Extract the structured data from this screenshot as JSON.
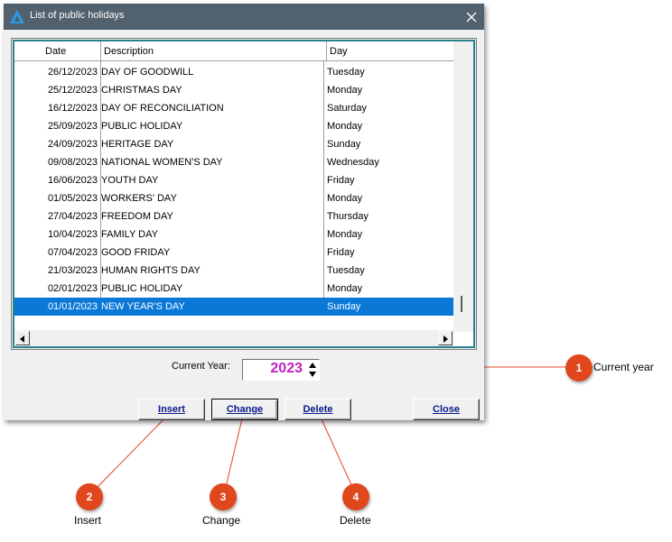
{
  "window": {
    "title": "List of public holidays",
    "icon": "app-triangle-icon",
    "close_icon": "close-icon"
  },
  "table": {
    "columns": [
      "Date",
      "Description",
      "Day"
    ],
    "rows": [
      {
        "date": "26/12/2023",
        "description": "DAY OF GOODWILL",
        "day": "Tuesday"
      },
      {
        "date": "25/12/2023",
        "description": "CHRISTMAS DAY",
        "day": "Monday"
      },
      {
        "date": "16/12/2023",
        "description": "DAY OF RECONCILIATION",
        "day": "Saturday"
      },
      {
        "date": "25/09/2023",
        "description": "PUBLIC HOLIDAY",
        "day": "Monday"
      },
      {
        "date": "24/09/2023",
        "description": "HERITAGE DAY",
        "day": "Sunday"
      },
      {
        "date": "09/08/2023",
        "description": "NATIONAL WOMEN'S DAY",
        "day": "Wednesday"
      },
      {
        "date": "16/06/2023",
        "description": "YOUTH DAY",
        "day": "Friday"
      },
      {
        "date": "01/05/2023",
        "description": "WORKERS' DAY",
        "day": "Monday"
      },
      {
        "date": "27/04/2023",
        "description": "FREEDOM DAY",
        "day": "Thursday"
      },
      {
        "date": "10/04/2023",
        "description": "FAMILY DAY",
        "day": "Monday"
      },
      {
        "date": "07/04/2023",
        "description": "GOOD FRIDAY",
        "day": "Friday"
      },
      {
        "date": "21/03/2023",
        "description": "HUMAN RIGHTS DAY",
        "day": "Tuesday"
      },
      {
        "date": "02/01/2023",
        "description": "PUBLIC HOLIDAY",
        "day": "Monday"
      },
      {
        "date": "01/01/2023",
        "description": "NEW YEAR'S DAY",
        "day": "Sunday"
      }
    ],
    "selected_index": 13
  },
  "year": {
    "label": "Current Year:",
    "value": "2023"
  },
  "buttons": {
    "insert": "Insert",
    "change": "Change",
    "delete": "Delete",
    "close": "Close"
  },
  "callouts": [
    {
      "number": "1",
      "label": "Current year"
    },
    {
      "number": "2",
      "label": "Insert"
    },
    {
      "number": "3",
      "label": "Change"
    },
    {
      "number": "4",
      "label": "Delete"
    }
  ],
  "colors": {
    "titlebar": "#51616d",
    "selection": "#0a78d7",
    "year_text": "#c020c0",
    "callout": "#e0471c",
    "button_text": "#0a1a8a"
  }
}
